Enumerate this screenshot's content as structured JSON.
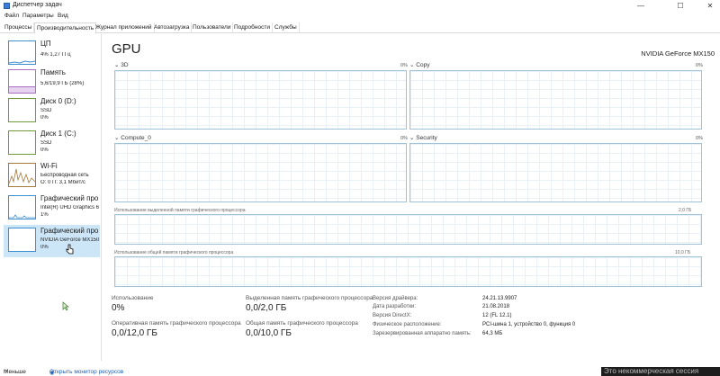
{
  "window": {
    "title": "Диспетчер задач",
    "minimize": "—",
    "maximize": "☐",
    "close": "✕"
  },
  "menu": [
    "Файл",
    "Параметры",
    "Вид"
  ],
  "tabs": [
    "Процессы",
    "Производительность",
    "Журнал приложений",
    "Автозагрузка",
    "Пользователи",
    "Подробности",
    "Службы"
  ],
  "sidebar": {
    "items": [
      {
        "title": "ЦП",
        "sub1": "4% 1,27 ГГц",
        "sub2": ""
      },
      {
        "title": "Память",
        "sub1": "5,6/19,9 ГБ (28%)",
        "sub2": ""
      },
      {
        "title": "Диск 0 (D:)",
        "sub1": "SSD",
        "sub2": "0%"
      },
      {
        "title": "Диск 1 (C:)",
        "sub1": "SSD",
        "sub2": "0%"
      },
      {
        "title": "Wi-Fi",
        "sub1": "Беспроводная сеть",
        "sub2": "О: 0 П: 3,1 Мбит/с"
      },
      {
        "title": "Графический про",
        "sub1": "Intel(R) UHD Graphics 6",
        "sub2": "1%"
      },
      {
        "title": "Графический про",
        "sub1": "NVIDIA GeForce MX150",
        "sub2": "0%"
      }
    ]
  },
  "main": {
    "title": "GPU",
    "model": "NVIDIA GeForce MX150",
    "engines": [
      {
        "label": "3D",
        "pct": "0%"
      },
      {
        "label": "Copy",
        "pct": "0%"
      },
      {
        "label": "Compute_0",
        "pct": "0%"
      },
      {
        "label": "Security",
        "pct": "0%"
      }
    ],
    "dedicated_label": "Использование выделенной памяти графического процессора",
    "dedicated_max": "2,0 ГБ",
    "shared_label": "Использование общей памяти графического процессора",
    "shared_max": "10,0 ГБ",
    "stats": {
      "usage_label": "Использование",
      "usage_value": "0%",
      "dedicated_label": "Выделенная память графического процессора",
      "dedicated_value": "0,0/2,0 ГБ",
      "ram_label": "Оперативная память графического процессора",
      "ram_value": "0,0/12,0 ГБ",
      "shared_label": "Общая память графического процессора",
      "shared_value": "0,0/10,0 ГБ"
    },
    "info": [
      {
        "key": "Версия драйвера:",
        "value": "24.21.13.9907"
      },
      {
        "key": "Дата разработки:",
        "value": "21.08.2018"
      },
      {
        "key": "Версия DirectX:",
        "value": "12 (FL 12.1)"
      },
      {
        "key": "Физическое расположение:",
        "value": "PCI-шина 1, устройство 0, функция 0"
      },
      {
        "key": "Зарезервированная аппаратно память:",
        "value": "64,3 МБ"
      }
    ]
  },
  "footer": {
    "less": "Меньше",
    "monitor": "Открыть монитор ресурсов"
  },
  "watermark": "Это некоммерческая сессия",
  "colors": {
    "selected_bg": "#cce6f7",
    "graph_border": "#9fc3da",
    "memory_thumb": "#a86fc2",
    "link": "#1c5fb5"
  }
}
